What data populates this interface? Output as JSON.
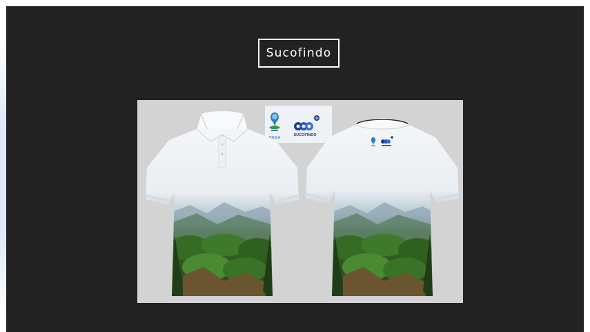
{
  "slide": {
    "title": "Sucofindo"
  },
  "logos": {
    "ensia_label": "ENSIA",
    "sucofindo_label": "SUCOFINDO"
  },
  "colors": {
    "slide_background": "#222222",
    "mockup_background": "#d3d3d4",
    "shirt_white": "#f1f4f7",
    "forest_green": "#2e5f1f",
    "mountain_blue": "#8fa6b2",
    "sucofindo_navy": "#1d3a8a",
    "ensia_blue": "#2a7fc1",
    "ensia_green": "#3a9a3a"
  },
  "icons": {
    "ensia": "ensia-logo-icon",
    "sucofindo": "sucofindo-logo-icon"
  }
}
